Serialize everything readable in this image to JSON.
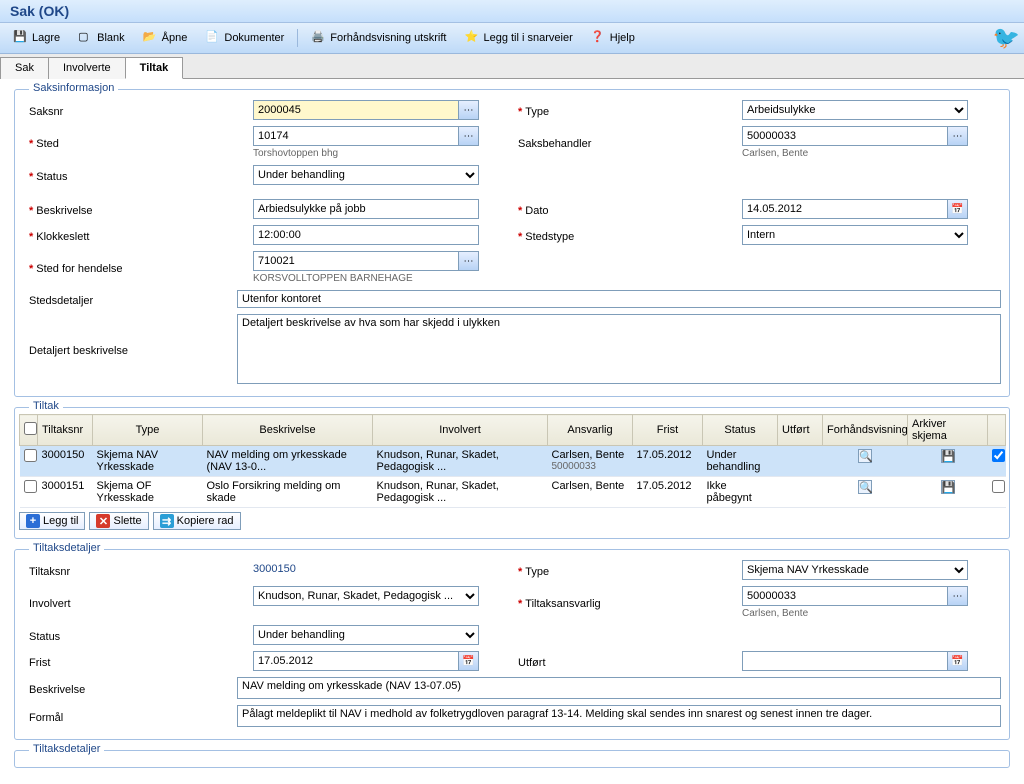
{
  "title": "Sak (OK)",
  "toolbar": {
    "lagre": "Lagre",
    "blank": "Blank",
    "apne": "Åpne",
    "dokumenter": "Dokumenter",
    "forhand": "Forhåndsvisning utskrift",
    "legg_snarvei": "Legg til i snarveier",
    "hjelp": "Hjelp"
  },
  "tabs": {
    "sak": "Sak",
    "involverte": "Involverte",
    "tiltak": "Tiltak"
  },
  "saksinfo": {
    "legend": "Saksinformasjon",
    "saksnr_label": "Saksnr",
    "saksnr_value": "2000045",
    "type_label": "Type",
    "type_value": "Arbeidsulykke",
    "sted_label": "Sted",
    "sted_value": "10174",
    "sted_hint": "Torshovtoppen bhg",
    "saksbehandler_label": "Saksbehandler",
    "saksbehandler_value": "50000033",
    "saksbehandler_hint": "Carlsen, Bente",
    "status_label": "Status",
    "status_value": "Under behandling",
    "beskrivelse_label": "Beskrivelse",
    "beskrivelse_value": "Arbiedsulykke på jobb",
    "dato_label": "Dato",
    "dato_value": "14.05.2012",
    "klokkeslett_label": "Klokkeslett",
    "klokkeslett_value": "12:00:00",
    "stedstype_label": "Stedstype",
    "stedstype_value": "Intern",
    "sted_hendelse_label": "Sted for hendelse",
    "sted_hendelse_value": "710021",
    "sted_hendelse_hint": "KORSVOLLTOPPEN BARNEHAGE",
    "stedsdetaljer_label": "Stedsdetaljer",
    "stedsdetaljer_value": "Utenfor kontoret",
    "detaljert_label": "Detaljert beskrivelse",
    "detaljert_value": "Detaljert beskrivelse av hva som har skjedd i ulykken"
  },
  "tiltak_section": {
    "legend": "Tiltak",
    "columns": {
      "tiltaksnr": "Tiltaksnr",
      "type": "Type",
      "beskrivelse": "Beskrivelse",
      "involvert": "Involvert",
      "ansvarlig": "Ansvarlig",
      "frist": "Frist",
      "status": "Status",
      "utfort": "Utført",
      "forhand": "Forhåndsvisning",
      "arkiver": "Arkiver skjema"
    },
    "rows": [
      {
        "tiltaksnr": "3000150",
        "type": "Skjema NAV Yrkesskade",
        "beskrivelse": "NAV melding om yrkesskade (NAV 13-0...",
        "involvert": "Knudson, Runar, Skadet, Pedagogisk ...",
        "ansvarlig": "Carlsen, Bente",
        "ansvarlig_sub": "50000033",
        "frist": "17.05.2012",
        "status": "Under behandling",
        "utfort": "",
        "checked": true
      },
      {
        "tiltaksnr": "3000151",
        "type": "Skjema OF Yrkesskade",
        "beskrivelse": "Oslo Forsikring melding om skade",
        "involvert": "Knudson, Runar, Skadet, Pedagogisk ...",
        "ansvarlig": "Carlsen, Bente",
        "ansvarlig_sub": "",
        "frist": "17.05.2012",
        "status": "Ikke påbegynt",
        "utfort": "",
        "checked": false
      }
    ],
    "actions": {
      "legg_til": "Legg til",
      "slette": "Slette",
      "kopiere": "Kopiere rad"
    }
  },
  "tiltaksdetaljer": {
    "legend": "Tiltaksdetaljer",
    "tiltaksnr_label": "Tiltaksnr",
    "tiltaksnr_value": "3000150",
    "type_label": "Type",
    "type_value": "Skjema NAV Yrkesskade",
    "involvert_label": "Involvert",
    "involvert_value": "Knudson, Runar, Skadet, Pedagogisk ...",
    "tiltaksansvarlig_label": "Tiltaksansvarlig",
    "tiltaksansvarlig_value": "50000033",
    "tiltaksansvarlig_hint": "Carlsen, Bente",
    "status_label": "Status",
    "status_value": "Under behandling",
    "frist_label": "Frist",
    "frist_value": "17.05.2012",
    "utfort_label": "Utført",
    "utfort_value": "",
    "beskrivelse_label": "Beskrivelse",
    "beskrivelse_value": "NAV melding om yrkesskade (NAV 13-07.05)",
    "formal_label": "Formål",
    "formal_value": "Pålagt meldeplikt til NAV i medhold av folketrygdloven paragraf 13-14. Melding skal sendes inn snarest og senest innen tre dager."
  },
  "tiltaksdetaljer2": {
    "legend": "Tiltaksdetaljer"
  }
}
